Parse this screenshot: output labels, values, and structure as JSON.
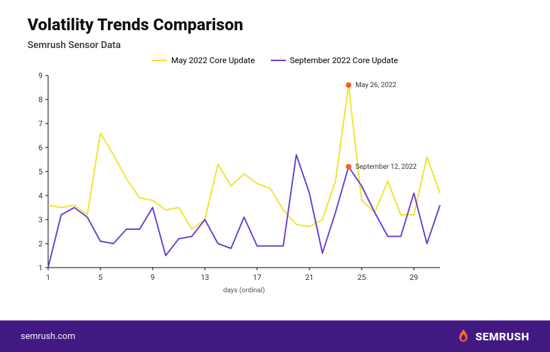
{
  "title": "Volatility Trends Comparison",
  "subtitle": "Semrush Sensor Data",
  "legend": {
    "may": "May 2022 Core Update",
    "sep": "September 2022 Core Update"
  },
  "footer": {
    "url": "semrush.com",
    "brand": "SEMRUSH"
  },
  "colors": {
    "may": "#f2e233",
    "sep": "#6a3dd1",
    "highlight": "#ff5b1f",
    "footer_bg": "#421983"
  },
  "chart_data": {
    "type": "line",
    "xlabel": "days (ordinal)",
    "ylabel": "",
    "ylim": [
      1,
      9
    ],
    "xlim": [
      1,
      31
    ],
    "x_ticks": [
      1,
      5,
      9,
      13,
      17,
      21,
      25,
      29
    ],
    "y_ticks": [
      1,
      2,
      3,
      4,
      5,
      6,
      7,
      8,
      9
    ],
    "x": [
      1,
      2,
      3,
      4,
      5,
      6,
      7,
      8,
      9,
      10,
      11,
      12,
      13,
      14,
      15,
      16,
      17,
      18,
      19,
      20,
      21,
      22,
      23,
      24,
      25,
      26,
      27,
      28,
      29,
      30,
      31
    ],
    "series": [
      {
        "name": "May 2022 Core Update",
        "color": "#f2e233",
        "values": [
          3.6,
          3.5,
          3.6,
          3.2,
          6.6,
          5.7,
          4.7,
          3.9,
          3.8,
          3.4,
          3.5,
          2.6,
          3.0,
          5.3,
          4.4,
          4.9,
          4.5,
          4.3,
          3.4,
          2.8,
          2.7,
          3.0,
          4.6,
          8.6,
          3.8,
          3.3,
          4.6,
          3.2,
          3.2,
          5.6,
          4.1
        ],
        "highlight": {
          "x": 24,
          "y": 8.6,
          "label": "May 26, 2022"
        }
      },
      {
        "name": "September 2022 Core Update",
        "color": "#6a3dd1",
        "values": [
          1.0,
          3.2,
          3.5,
          3.1,
          2.1,
          2.0,
          2.6,
          2.6,
          3.5,
          1.5,
          2.2,
          2.3,
          3.0,
          2.0,
          1.8,
          3.1,
          1.9,
          1.9,
          1.9,
          5.7,
          4.1,
          1.6,
          3.3,
          5.2,
          4.4,
          3.3,
          2.3,
          2.3,
          4.1,
          2.0,
          3.6
        ],
        "highlight": {
          "x": 24,
          "y": 5.2,
          "label": "September 12, 2022"
        }
      }
    ]
  }
}
